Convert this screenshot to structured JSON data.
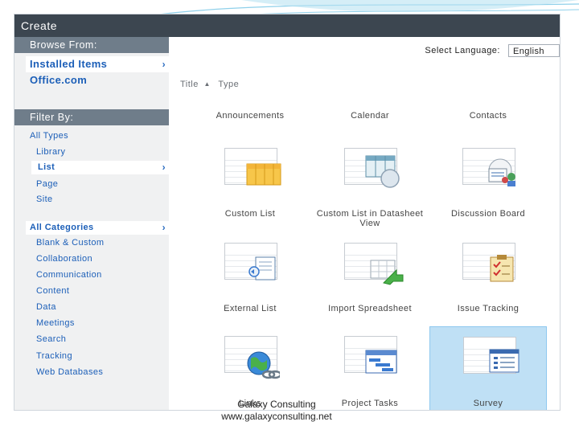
{
  "dialog": {
    "title": "Create"
  },
  "sidebar": {
    "browse_header": "Browse From:",
    "browse_items": [
      {
        "label": "Installed Items",
        "selected": true
      },
      {
        "label": "Office.com",
        "selected": false
      }
    ],
    "filter_header": "Filter By:",
    "types_heading": "All Types",
    "types": [
      {
        "label": "Library"
      },
      {
        "label": "List",
        "selected": true
      },
      {
        "label": "Page"
      },
      {
        "label": "Site"
      }
    ],
    "categories_heading": "All Categories",
    "categories": [
      {
        "label": "Blank & Custom"
      },
      {
        "label": "Collaboration"
      },
      {
        "label": "Communication"
      },
      {
        "label": "Content"
      },
      {
        "label": "Data"
      },
      {
        "label": "Meetings"
      },
      {
        "label": "Search"
      },
      {
        "label": "Tracking"
      },
      {
        "label": "Web Databases"
      }
    ]
  },
  "main": {
    "language_label": "Select Language:",
    "language_value": "English",
    "sort_title": "Title",
    "sort_type": "Type",
    "top_labels": [
      "Announcements",
      "Calendar",
      "Contacts"
    ],
    "tiles": [
      {
        "label": "Custom List",
        "icon": "custom-list-icon"
      },
      {
        "label": "Custom List in Datasheet View",
        "icon": "datasheet-list-icon"
      },
      {
        "label": "Discussion Board",
        "icon": "discussion-board-icon"
      },
      {
        "label": "External List",
        "icon": "external-list-icon"
      },
      {
        "label": "Import Spreadsheet",
        "icon": "import-spreadsheet-icon"
      },
      {
        "label": "Issue Tracking",
        "icon": "issue-tracking-icon"
      },
      {
        "label": "Links",
        "icon": "links-icon"
      },
      {
        "label": "Project Tasks",
        "icon": "project-tasks-icon"
      },
      {
        "label": "Survey",
        "icon": "survey-icon",
        "selected": true
      }
    ]
  },
  "footer": {
    "company": "Galaxy Consulting",
    "url": "www.galaxyconsulting.net"
  },
  "colors": {
    "title_bar": "#3c4650",
    "section_header": "#6f7d8a",
    "link_blue": "#1c5fb8",
    "selected_tile": "#bfe0f5"
  }
}
